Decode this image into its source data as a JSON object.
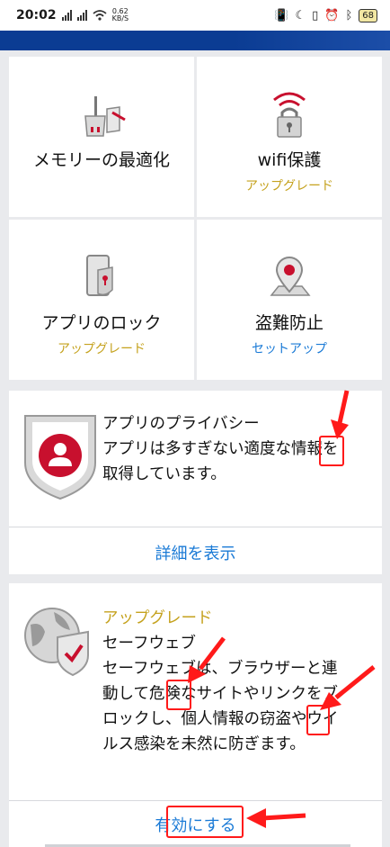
{
  "status_bar": {
    "time": "20:02",
    "net_speed": "0.62",
    "net_unit": "KB/S",
    "battery": "68"
  },
  "features": [
    {
      "title": "メモリーの最適化",
      "subtitle": "",
      "icon": "broom-memory-icon"
    },
    {
      "title": "wifi保護",
      "subtitle": "アップグレード",
      "icon": "wifi-lock-icon"
    },
    {
      "title": "アプリのロック",
      "subtitle": "アップグレード",
      "icon": "phone-lock-icon"
    },
    {
      "title": "盗難防止",
      "subtitle": "セットアップ",
      "icon": "map-pin-icon"
    }
  ],
  "privacy_card": {
    "title": "アプリのプライバシー",
    "body_line1": "アプリは多すぎない適度な情報を",
    "body_line2": "取得しています。",
    "link": "詳細を表示",
    "icon": "user-shield-icon"
  },
  "safeweb_card": {
    "tag": "アップグレード",
    "title": "セーフウェブ",
    "lines": [
      "セーフウェブは、ブラウザーと連",
      "動して危険なサイトやリンクをブ",
      "ロックし、個人情報の窃盗やウイ",
      "ルス感染を未然に防ぎます。"
    ],
    "link": "有効にする",
    "icon": "globe-shield-icon"
  },
  "colors": {
    "accent_blue": "#1a7ad6",
    "upgrade_gold": "#c5a21e",
    "brand_red": "#c8102e",
    "appbar_blue": "#0b3c93",
    "annotation_red": "#ff1a1a"
  }
}
